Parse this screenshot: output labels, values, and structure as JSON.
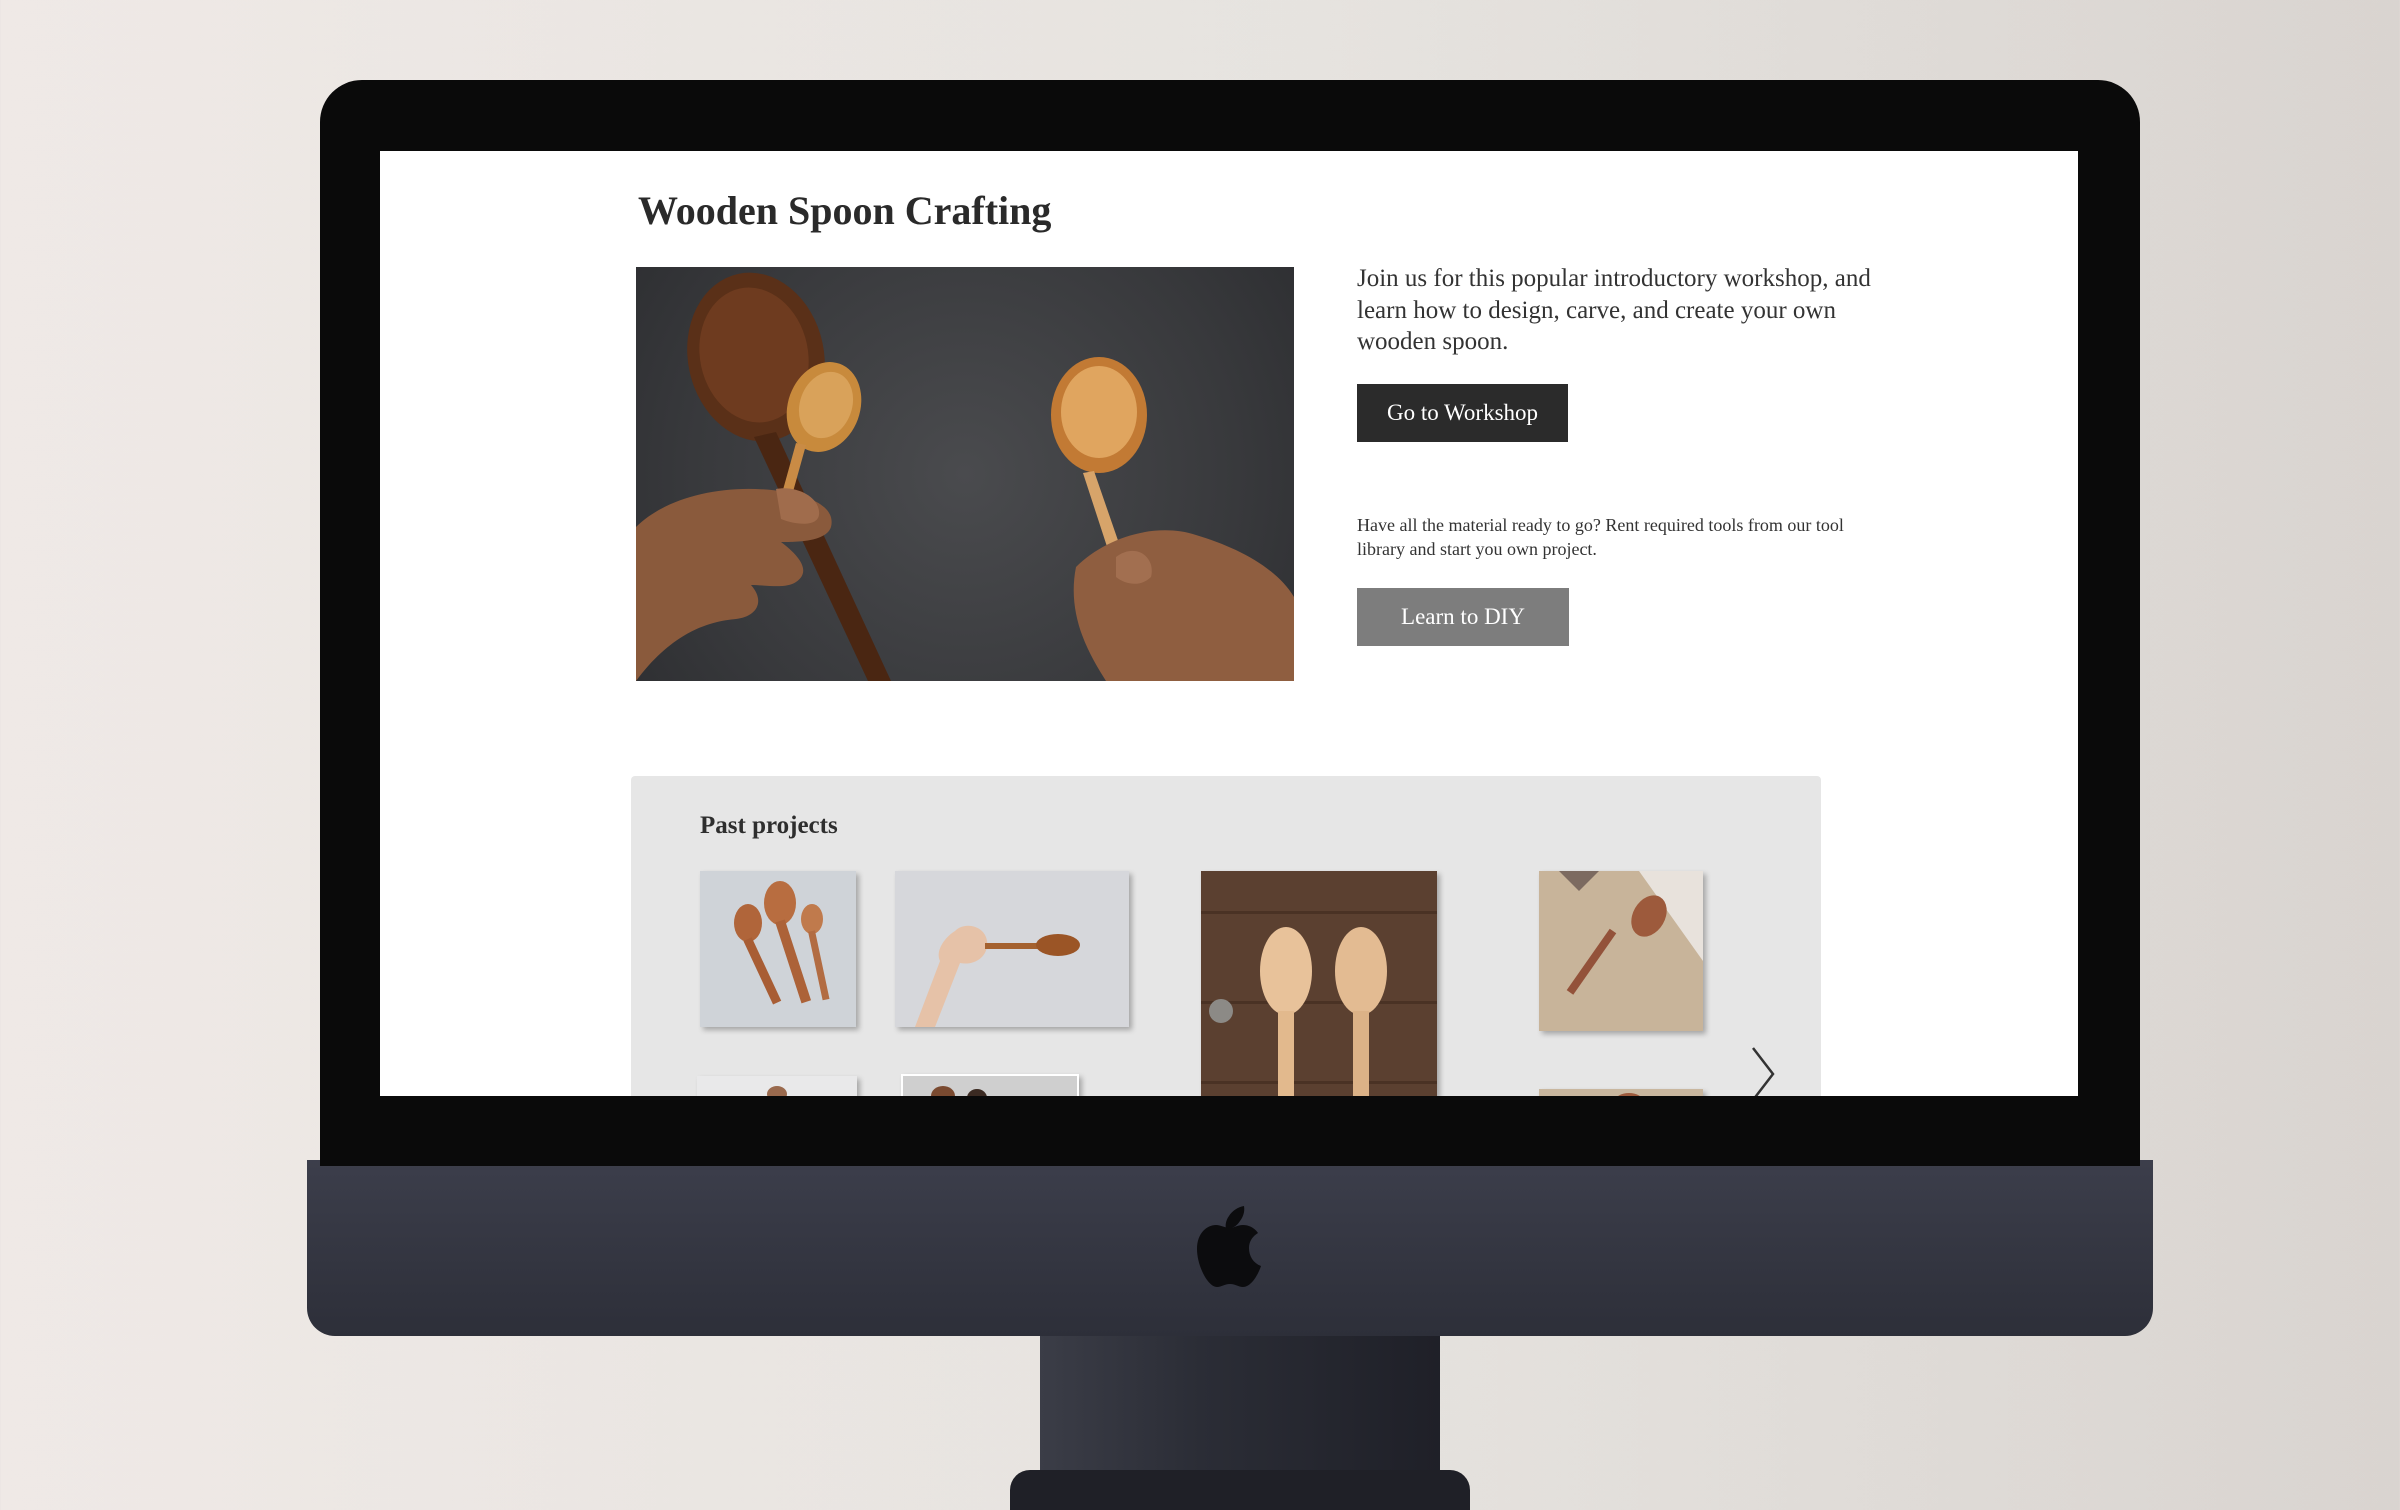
{
  "page": {
    "title": "Wooden Spoon Crafting",
    "description": "Join us for this popular introductory workshop, and learn how to design, carve, and create your own wooden spoon.",
    "workshop_button": "Go to Workshop",
    "diy_note": "Have all the material ready to go? Rent required tools from our tool library and start you own project.",
    "diy_button": "Learn to DIY"
  },
  "past_projects": {
    "title": "Past projects",
    "next_icon": "chevron-right-icon"
  },
  "colors": {
    "workshop_button_bg": "#2b2b2b",
    "diy_button_bg": "#7d7d7d",
    "section_bg": "#e6e6e6"
  }
}
